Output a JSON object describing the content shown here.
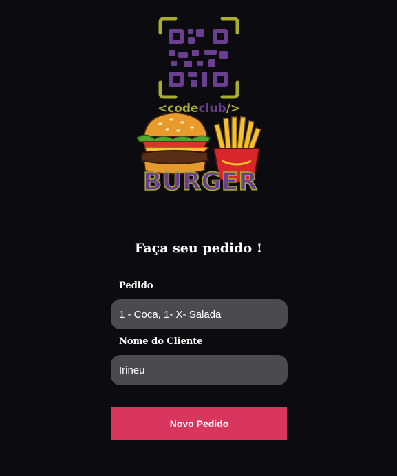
{
  "logo": {
    "brand_text": "<codeclub/>",
    "burger_text": "BURGER",
    "icons": [
      "qr-code-icon",
      "burger-icon",
      "fries-icon"
    ]
  },
  "form": {
    "title": "Faça seu pedido !",
    "order_label": "Pedido",
    "order_value": "1 - Coca, 1- X- Salada",
    "client_label": "Nome do Cliente",
    "client_value": "Irineu",
    "submit_label": "Novo Pedido"
  },
  "colors": {
    "background": "#0c0b10",
    "input_bg": "#4b4a50",
    "button": "#d8365c",
    "qr_purple": "#6b3f8f",
    "qr_frame": "#a8ad2c",
    "burger_text": "#6b3f8f"
  }
}
